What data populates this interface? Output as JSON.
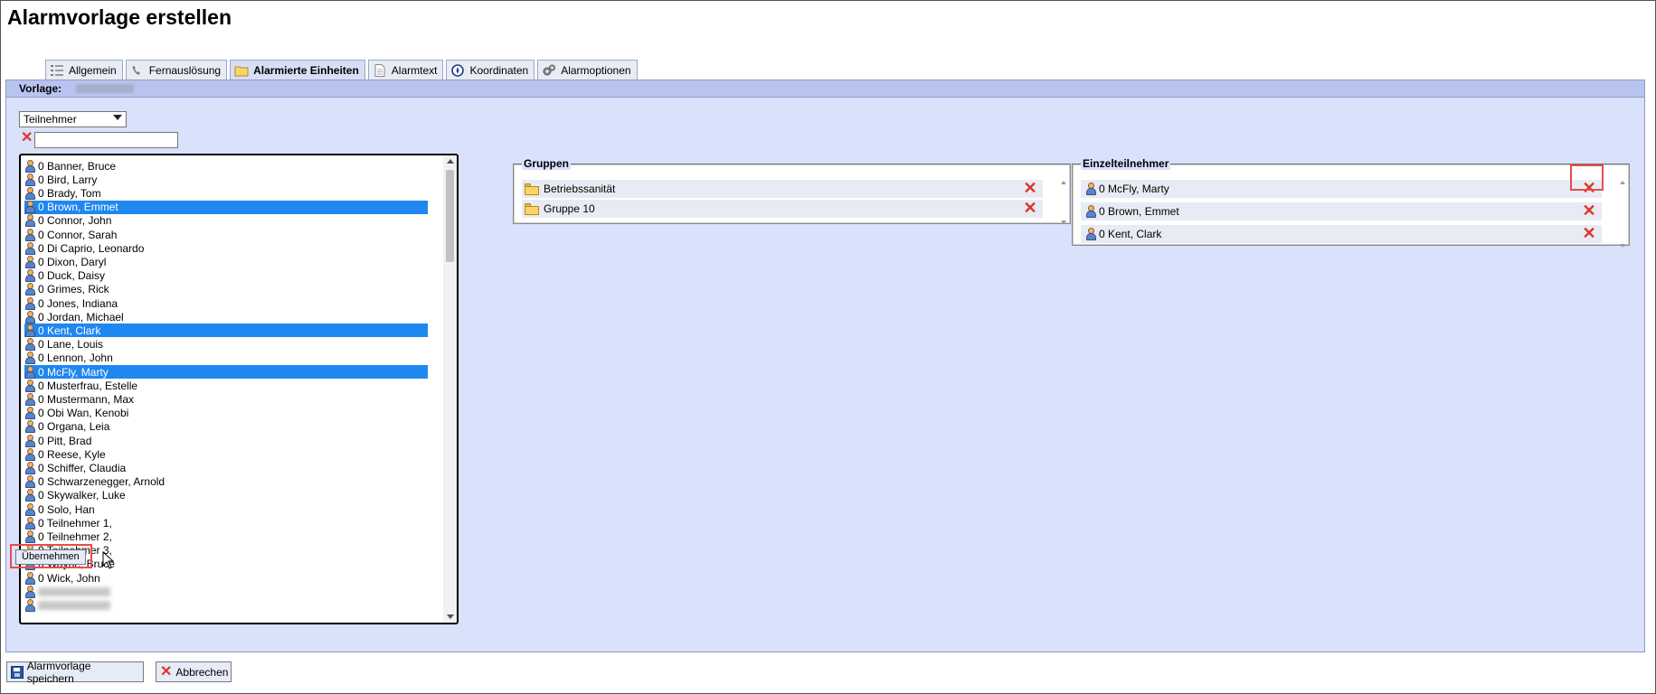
{
  "page": {
    "title": "Alarmvorlage erstellen"
  },
  "tabs": [
    {
      "label": "Allgemein",
      "icon": "list-icon"
    },
    {
      "label": "Fernauslösung",
      "icon": "phone-icon"
    },
    {
      "label": "Alarmierte Einheiten",
      "icon": "folder-icon",
      "active": true
    },
    {
      "label": "Alarmtext",
      "icon": "document-icon"
    },
    {
      "label": "Koordinaten",
      "icon": "compass-icon"
    },
    {
      "label": "Alarmoptionen",
      "icon": "gears-icon"
    }
  ],
  "vorlage": {
    "label": "Vorlage:"
  },
  "type_select": {
    "value": "Teilnehmer"
  },
  "filter": {
    "value": ""
  },
  "participant_list": [
    {
      "label": "0 Banner, Bruce",
      "selected": false
    },
    {
      "label": "0 Bird, Larry",
      "selected": false
    },
    {
      "label": "0 Brady, Tom",
      "selected": false
    },
    {
      "label": "0 Brown, Emmet",
      "selected": true
    },
    {
      "label": "0 Connor, John",
      "selected": false
    },
    {
      "label": "0 Connor, Sarah",
      "selected": false
    },
    {
      "label": "0 Di Caprio, Leonardo",
      "selected": false
    },
    {
      "label": "0 Dixon, Daryl",
      "selected": false
    },
    {
      "label": "0 Duck, Daisy",
      "selected": false
    },
    {
      "label": "0 Grimes, Rick",
      "selected": false
    },
    {
      "label": "0 Jones, Indiana",
      "selected": false
    },
    {
      "label": "0 Jordan, Michael",
      "selected": false
    },
    {
      "label": "0 Kent, Clark",
      "selected": true
    },
    {
      "label": "0 Lane, Louis",
      "selected": false
    },
    {
      "label": "0 Lennon, John",
      "selected": false
    },
    {
      "label": "0 McFly, Marty",
      "selected": true
    },
    {
      "label": "0 Musterfrau, Estelle",
      "selected": false
    },
    {
      "label": "0 Mustermann, Max",
      "selected": false
    },
    {
      "label": "0 Obi Wan, Kenobi",
      "selected": false
    },
    {
      "label": "0 Organa, Leia",
      "selected": false
    },
    {
      "label": "0 Pitt, Brad",
      "selected": false
    },
    {
      "label": "0 Reese, Kyle",
      "selected": false
    },
    {
      "label": "0 Schiffer, Claudia",
      "selected": false
    },
    {
      "label": "0 Schwarzenegger, Arnold",
      "selected": false
    },
    {
      "label": "0 Skywalker, Luke",
      "selected": false
    },
    {
      "label": "0 Solo, Han",
      "selected": false
    },
    {
      "label": "0 Teilnehmer 1,",
      "selected": false
    },
    {
      "label": "0 Teilnehmer 2,",
      "selected": false
    },
    {
      "label": "0 Teilnehmer 3,",
      "selected": false
    },
    {
      "label": "0 Wayne, Bruce",
      "selected": false
    },
    {
      "label": "0 Wick, John",
      "selected": false
    }
  ],
  "apply_button": {
    "label": "Übernehmen"
  },
  "gruppen": {
    "legend": "Gruppen",
    "items": [
      "Betriebssanität",
      "Gruppe 10"
    ]
  },
  "einzelteilnehmer": {
    "legend": "Einzelteilnehmer",
    "items": [
      "0 McFly, Marty",
      "0 Brown, Emmet",
      "0 Kent, Clark"
    ]
  },
  "footer": {
    "save_label": "Alarmvorlage speichern",
    "cancel_label": "Abbrechen"
  },
  "colors": {
    "panel_bg": "#d9e1fb",
    "selection": "#1f87f0",
    "highlight": "#e94c4c",
    "delete": "#d9362b"
  }
}
